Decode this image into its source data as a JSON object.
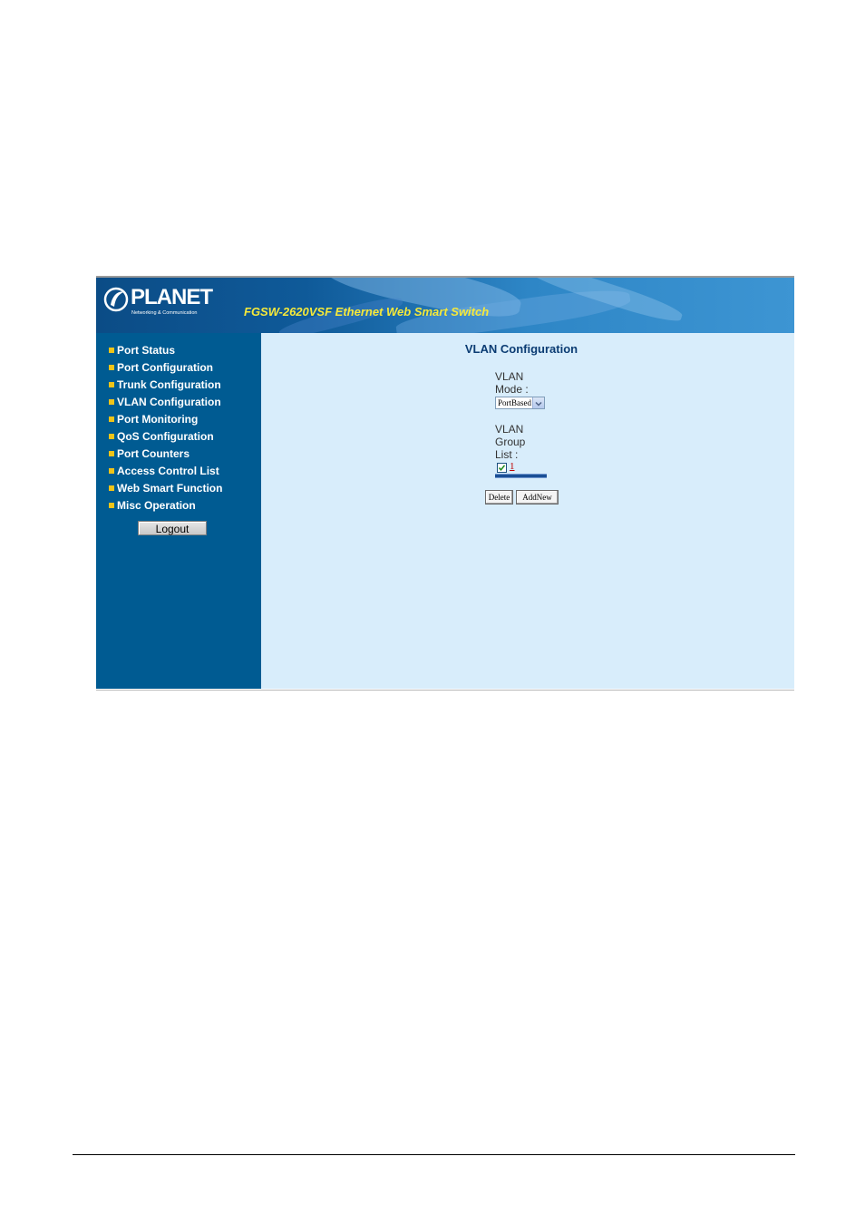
{
  "header": {
    "logo_text": "PLANET",
    "logo_tagline": "Networking & Communication",
    "product_title": "FGSW-2620VSF Ethernet Web Smart Switch"
  },
  "sidebar": {
    "items": [
      {
        "label": "Port Status"
      },
      {
        "label": "Port Configuration"
      },
      {
        "label": "Trunk Configuration"
      },
      {
        "label": "VLAN Configuration"
      },
      {
        "label": "Port Monitoring"
      },
      {
        "label": "QoS Configuration"
      },
      {
        "label": "Port Counters"
      },
      {
        "label": "Access Control List"
      },
      {
        "label": "Web Smart Function"
      },
      {
        "label": "Misc Operation"
      }
    ],
    "logout_label": "Logout"
  },
  "main": {
    "title": "VLAN Configuration",
    "mode_label_line1": "VLAN",
    "mode_label_line2": "Mode :",
    "mode_value": "PortBased",
    "group_label_line1": "VLAN",
    "group_label_line2": "Group",
    "group_label_line3": "List :",
    "group_items": [
      "1"
    ],
    "delete_label": "Delete",
    "addnew_label": "AddNew"
  },
  "colors": {
    "sidebar_bg": "#005b92",
    "content_bg": "#d8edfb",
    "title_yellow": "#f6e93a",
    "bullet": "#f0c419"
  }
}
